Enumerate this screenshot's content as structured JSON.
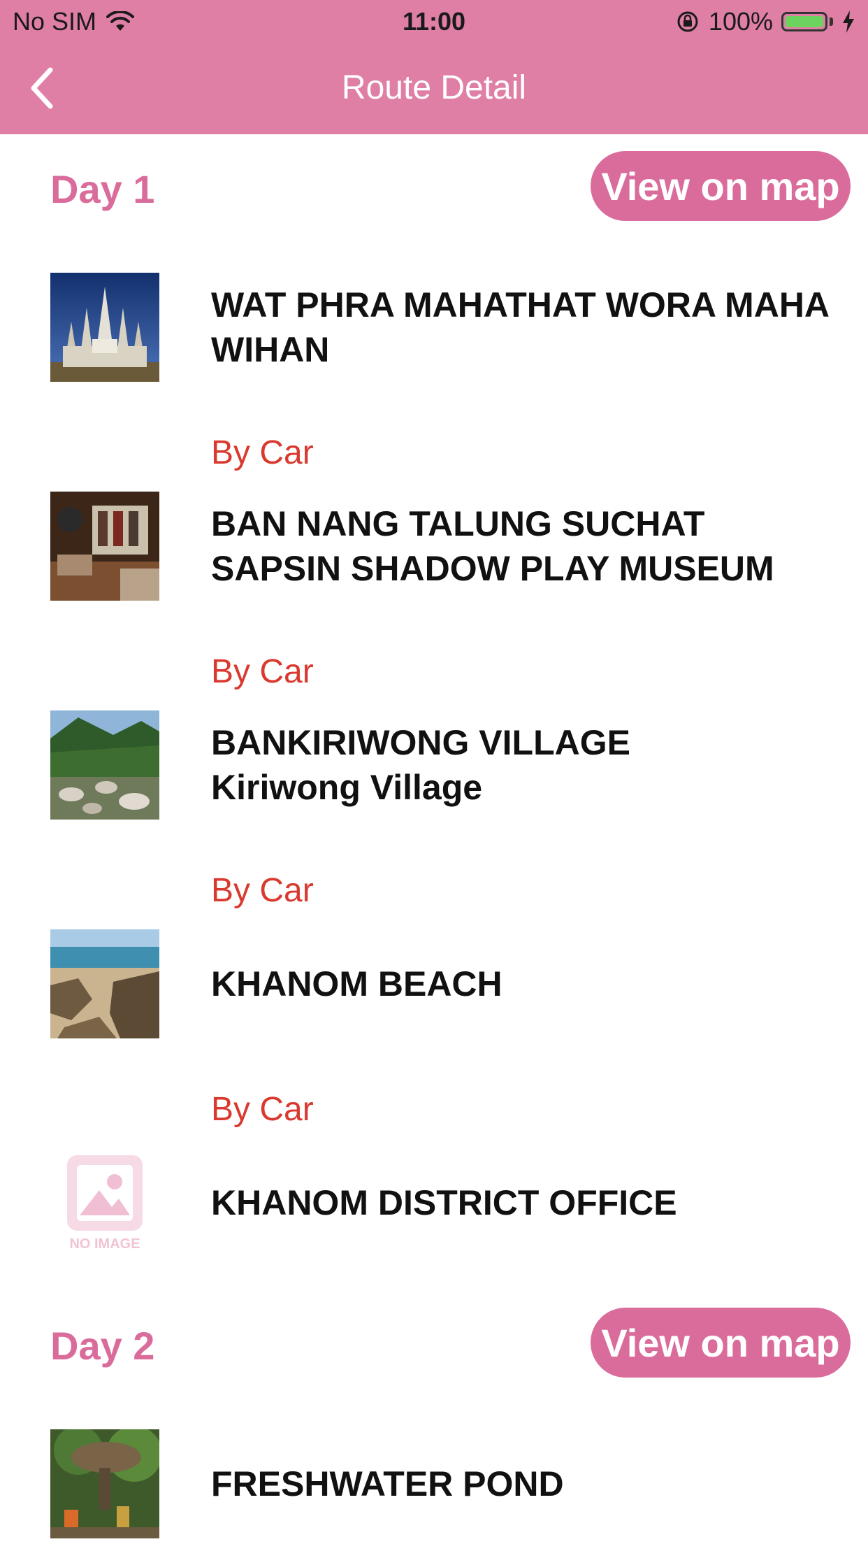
{
  "status_bar": {
    "carrier": "No SIM",
    "time": "11:00",
    "battery": "100%"
  },
  "header": {
    "title": "Route Detail"
  },
  "days": [
    {
      "label": "Day 1",
      "map_button": "View on map",
      "places": [
        {
          "name": "WAT PHRA MAHATHAT WORA MAHA WIHAN",
          "image": "temple-photo"
        },
        {
          "transport": "By Car"
        },
        {
          "name": "BAN NANG TALUNG SUCHAT SAPSIN SHADOW PLAY MUSEUM",
          "image": "museum-photo"
        },
        {
          "transport": "By Car"
        },
        {
          "name": "BANKIRIWONG VILLAGE\n Kiriwong Village",
          "image": "village-photo"
        },
        {
          "transport": "By Car"
        },
        {
          "name": "KHANOM BEACH",
          "image": "beach-photo"
        },
        {
          "transport": "By Car"
        },
        {
          "name": "KHANOM DISTRICT OFFICE",
          "image": "no-image",
          "image_label": "NO IMAGE"
        }
      ]
    },
    {
      "label": "Day 2",
      "map_button": "View on map",
      "places": [
        {
          "name": "FRESHWATER POND",
          "image": "pond-photo"
        }
      ]
    }
  ],
  "colors": {
    "header": "#E07FA5",
    "accent": "#DA6C9C",
    "transport": "#D9392E",
    "battery": "#6CD35E"
  }
}
